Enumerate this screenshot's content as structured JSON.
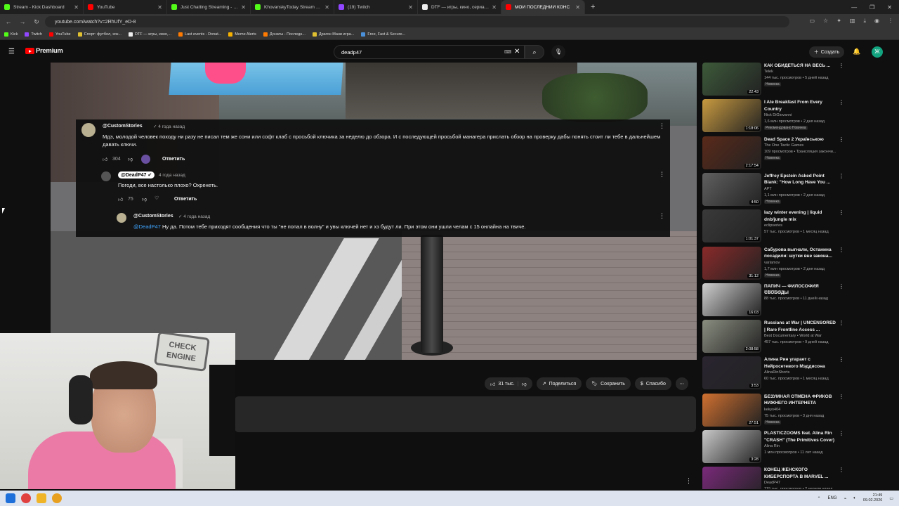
{
  "browser": {
    "tabs": [
      {
        "title": "Stream - Kick Dashboard",
        "color": "#53fc18"
      },
      {
        "title": "YouTube",
        "color": "#ff0000"
      },
      {
        "title": "Just Chatting Streaming - Live S",
        "color": "#53fc18"
      },
      {
        "title": "KhovanskyToday Stream - Watc",
        "color": "#53fc18"
      },
      {
        "title": "(19) Twitch",
        "color": "#9146ff"
      },
      {
        "title": "DTF — игры, кино, сериалы, р",
        "color": "#eeeeee"
      },
      {
        "title": "МОЙ ПОСЛЕДНИЙ КОНС",
        "color": "#ff0000"
      }
    ],
    "url": "youtube.com/watch?v=2RhUfY_eD-8",
    "bookmarks": [
      {
        "label": "Kick",
        "color": "#53fc18"
      },
      {
        "label": "Twitch",
        "color": "#9146ff"
      },
      {
        "label": "YouTube",
        "color": "#ff0000"
      },
      {
        "label": "Спорт: футбол, хок...",
        "color": "#e0c030"
      },
      {
        "label": "DTF — игры, кино,...",
        "color": "#eeeeee"
      },
      {
        "label": "Last events - Donat...",
        "color": "#ff7a00"
      },
      {
        "label": "Meme Alerts",
        "color": "#f5b000"
      },
      {
        "label": "Донаты - Последн...",
        "color": "#ff7a00"
      },
      {
        "label": "Драгон Мани игра...",
        "color": "#e0c030"
      },
      {
        "label": "Free, Fast & Secure...",
        "color": "#4a90d9"
      }
    ]
  },
  "yt_header": {
    "logo": "Premium",
    "search_value": "deadp47",
    "create_label": "Создать",
    "avatar_letter": "Ж"
  },
  "comments": [
    {
      "author": "@CustomStories",
      "time": "4 года назад",
      "text": "Мдэ, молодой человек походу ни разу не писал тем же сони или софт клаб с просьбой ключика за неделю до обзора. И с последующей просьбой манагера прислать обзор на проверку дабы понять стоит ли тебе в дальнейшем давать ключи.",
      "likes": "304",
      "reply": "Ответить"
    },
    {
      "author": "@DeadP47",
      "time": "4 года назад",
      "text": "Погоди, все настолько плохо? Охренеть.",
      "likes": "75",
      "reply": "Ответить"
    },
    {
      "author": "@CustomStories",
      "time": "4 года назад",
      "mention": "@DeadP47",
      "text": " Ну да. Потом тебе приходят сообщения что ты \"не попал в волну\" и увы ключей нет и хз будут ли. При этом они ушли челам с 15 онлайна на твиче."
    }
  ],
  "actions": {
    "likes": "31 тыс.",
    "share": "Поделиться",
    "save": "Сохранить",
    "thanks": "Спасибо"
  },
  "webcam_sign": "CHECK ENGINE",
  "recommendations": [
    {
      "title": "КАК ОБИДЕТЬСЯ НА ВЕСЬ ...",
      "channel": "Telek",
      "meta": "144 тыс. просмотров • 5 дней назад",
      "badge": "Новинка",
      "duration": "22:43",
      "color": "#3d5a3a"
    },
    {
      "title": "I Ate Breakfast From Every Country",
      "channel": "Nick DiGiovanni",
      "meta": "1,6 млн просмотров • 2 дня назад",
      "badge": "Рекомендовано  Новинка",
      "duration": "1:18:06",
      "color": "#c89a40"
    },
    {
      "title": "Dead Space 2 Українською",
      "channel": "The One Tactic Games",
      "meta": "109 просмотров • Трансляция закончи...",
      "badge": "Новинка",
      "duration": "2:17:54",
      "color": "#5a2a1a"
    },
    {
      "title": "Jeffrey Epstein Asked Point Blank: \"How Long Have You ...",
      "channel": "APT",
      "meta": "1,1 млн просмотров • 2 дня назад",
      "badge": "Новинка",
      "duration": "4:50",
      "color": "#606060"
    },
    {
      "title": "lazy winter evening | liquid dnb/jungle mix",
      "channel": "eclipseries",
      "meta": "57 тыс. просмотров • 1 месяц назад",
      "badge": "",
      "duration": "1:01:37",
      "color": "#3a3a3a"
    },
    {
      "title": "Сабурова выгнали, Останина посадили: шутки вне закона...",
      "channel": "varlamov",
      "meta": "1,7 млн просмотров • 2 дня назад",
      "badge": "Новинка",
      "duration": "31:12",
      "color": "#8a2a2a"
    },
    {
      "title": "ПАПИЧ — ФИЛОСОФИЯ СВОБОДЫ",
      "channel": "M3RTALE",
      "meta": "88 тыс. просмотров • 11 дней назад",
      "badge": "",
      "duration": "16:03",
      "color": "#cfcfcf"
    },
    {
      "title": "Russians at War | UNCENSORED | Rare Frontline Access ...",
      "channel": "Best Documentary • World at War",
      "meta": "457 тыс. просмотров • 9 дней назад",
      "badge": "",
      "duration": "2:08:58",
      "color": "#8a8e80"
    },
    {
      "title": "Алина Рин угарает с Нейросетевого Мэддисона",
      "channel": "AlinaRinShorts",
      "meta": "60 тыс. просмотров • 1 месяц назад",
      "badge": "",
      "duration": "3:53",
      "color": "#2a2530"
    },
    {
      "title": "БЕЗУМНАЯ ОТМЕНА ФРИКОВ НИЖНЕГО ИНТЕРНЕТА",
      "channel": "kekys404",
      "meta": "75 тыс. просмотров • 3 дня назад",
      "badge": "Новинка",
      "duration": "27:51",
      "color": "#d07030"
    },
    {
      "title": "PLASTICZOOMS feat. Alina Rin \"CRASH\" (The Primitives Cover)",
      "channel": "Alina Rin",
      "meta": "1 млн просмотров • 11 лет назад",
      "badge": "",
      "duration": "3:28",
      "color": "#c8c8c8"
    },
    {
      "title": "КОНЕЦ ЖЕНСКОГО КИБЕРСПОРТА В MARVEL ...",
      "channel": "DeadP47",
      "meta": "715 тыс. просмотров • 2 недели назад",
      "badge": "",
      "duration": "15:00",
      "color": "#7a2a7a"
    }
  ],
  "taskbar": {
    "lang": "ENG",
    "time": "21:49",
    "date": "09.02.2026"
  }
}
